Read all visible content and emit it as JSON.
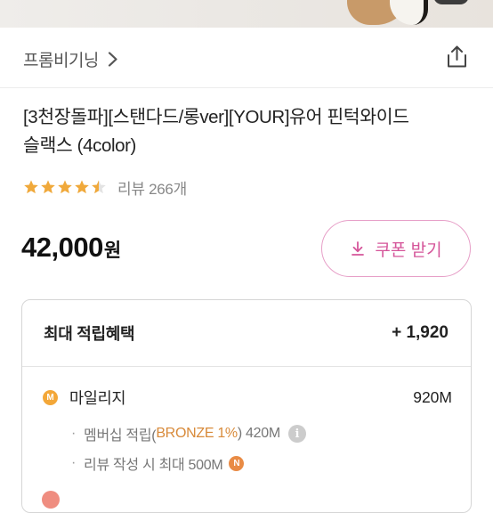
{
  "brand": {
    "name": "프롬비기닝"
  },
  "product": {
    "title_line1": "[3천장돌파][스탠다드/롱ver][YOUR]유어 핀턱와이드",
    "title_line2": "슬랙스 (4color)",
    "rating": 4.5,
    "review_text": "리뷰 266개",
    "price": "42,000",
    "price_unit": "원"
  },
  "coupon": {
    "label": "쿠폰 받기"
  },
  "benefits": {
    "title": "최대 적립혜택",
    "total": "+ 1,920",
    "mileage": {
      "badge": "M",
      "label": "마일리지",
      "value": "920M",
      "membership_prefix": "멤버십 적립(",
      "membership_grade": "BRONZE 1%",
      "membership_suffix": ") 420M",
      "review_line": "리뷰 작성 시 최대 500M",
      "review_badge": "N",
      "bullet": "·",
      "info_glyph": "i"
    }
  },
  "colors": {
    "accent": "#d5559a",
    "star": "#f0a93b",
    "mileage_badge": "#f3a738",
    "grade_text": "#d88a3a"
  },
  "icons": [
    "chevron-right-icon",
    "share-icon",
    "star-icon",
    "download-icon",
    "info-icon"
  ]
}
